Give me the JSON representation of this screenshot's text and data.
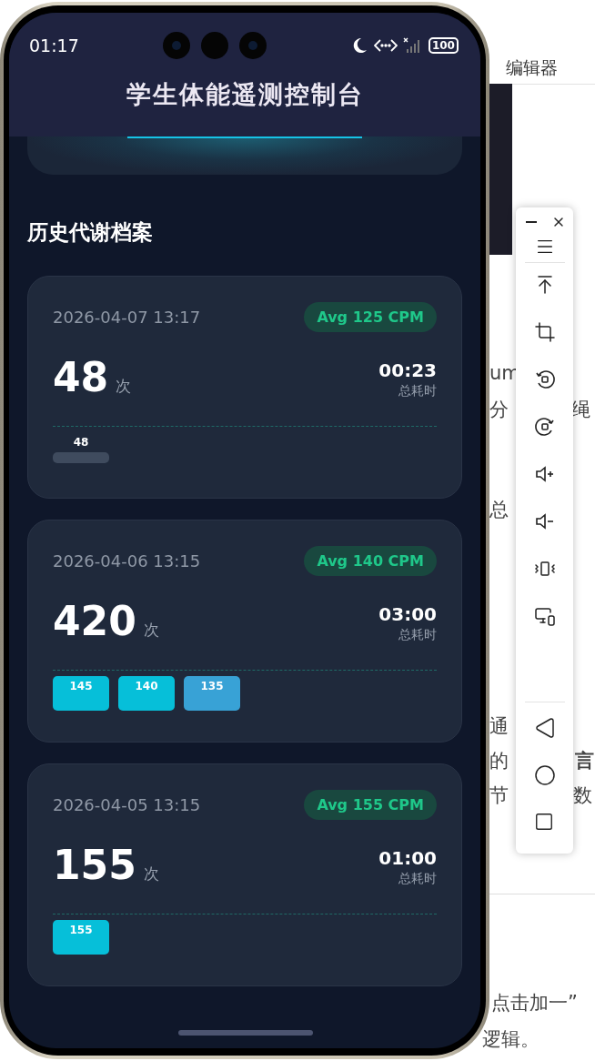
{
  "background_page": {
    "header_text": "编辑器",
    "fragments": [
      "um",
      "分",
      "绳",
      "总",
      "通",
      "的",
      "言",
      "节",
      "数",
      "点击加一”",
      "逻辑。"
    ]
  },
  "status_bar": {
    "time": "01:17",
    "battery": "100"
  },
  "app": {
    "title": "学生体能遥测控制台",
    "section_title": "历史代谢档案"
  },
  "records": [
    {
      "datetime": "2026-04-07 13:17",
      "avg_badge": "Avg 125 CPM",
      "count": "48",
      "count_unit": "次",
      "duration": "00:23",
      "duration_label": "总耗时",
      "bars": [
        {
          "value": "48",
          "kind": "low",
          "color": "#3f4b5e"
        }
      ]
    },
    {
      "datetime": "2026-04-06 13:15",
      "avg_badge": "Avg 140 CPM",
      "count": "420",
      "count_unit": "次",
      "duration": "03:00",
      "duration_label": "总耗时",
      "bars": [
        {
          "value": "145",
          "kind": "full",
          "color": "#06bfd9"
        },
        {
          "value": "140",
          "kind": "full",
          "color": "#06bfd9"
        },
        {
          "value": "135",
          "kind": "full",
          "color": "#38a2d6"
        }
      ]
    },
    {
      "datetime": "2026-04-05 13:15",
      "avg_badge": "Avg 155 CPM",
      "count": "155",
      "count_unit": "次",
      "duration": "01:00",
      "duration_label": "总耗时",
      "bars": [
        {
          "value": "155",
          "kind": "full",
          "color": "#06bfd9"
        }
      ]
    }
  ]
}
